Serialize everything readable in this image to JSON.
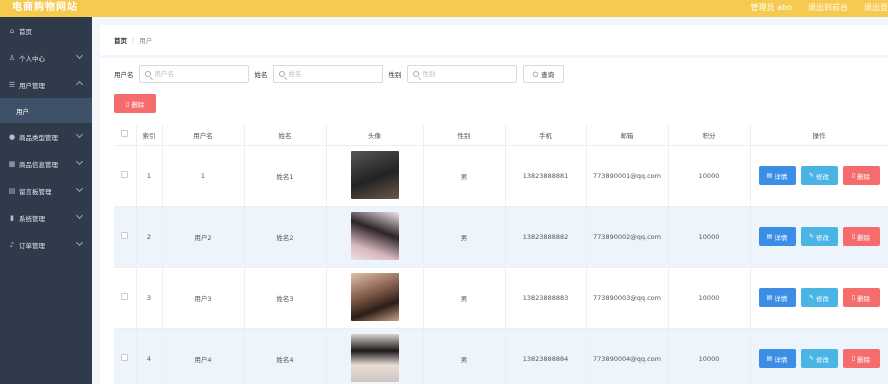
{
  "header": {
    "brand": "电商购物网站",
    "links": [
      "管理员 abo",
      "退出到前台",
      "退出登"
    ]
  },
  "sidebar": {
    "items": [
      {
        "label": "首页",
        "icon": "home-icon",
        "glyph": "⌂",
        "chevron": false
      },
      {
        "label": "个人中心",
        "icon": "user-icon",
        "glyph": "♙",
        "chevron": true
      },
      {
        "label": "用户管理",
        "icon": "menu-icon",
        "glyph": "☰",
        "chevron": true
      },
      {
        "label": "商品类型管理",
        "icon": "location-icon",
        "glyph": "●",
        "chevron": true
      },
      {
        "label": "商品信息管理",
        "icon": "grid-icon",
        "glyph": "▦",
        "chevron": true
      },
      {
        "label": "留言板管理",
        "icon": "calendar-icon",
        "glyph": "▤",
        "chevron": true
      },
      {
        "label": "系统管理",
        "icon": "chart-icon",
        "glyph": "▮",
        "chevron": true
      },
      {
        "label": "订单管理",
        "icon": "mic-icon",
        "glyph": "♪",
        "chevron": true
      }
    ],
    "sub_active": "用户"
  },
  "breadcrumb": {
    "home": "首页",
    "sep": "/",
    "current": "用户"
  },
  "search": {
    "username_label": "用户名",
    "username_placeholder": "用户名",
    "name_label": "姓名",
    "name_placeholder": "姓名",
    "gender_label": "性别",
    "gender_placeholder": "性别",
    "query_label": "查询"
  },
  "toolbar": {
    "delete_label": "删除"
  },
  "table": {
    "headers": [
      "索引",
      "用户名",
      "姓名",
      "头像",
      "性别",
      "手机",
      "邮箱",
      "积分",
      "操作"
    ],
    "rows": [
      {
        "index": "1",
        "username": "1",
        "name": "姓名1",
        "gender": "男",
        "phone": "13823888881",
        "email": "773890001@qq.com",
        "points": "10000",
        "avatar_color": "#3a3a3a"
      },
      {
        "index": "2",
        "username": "用户2",
        "name": "姓名2",
        "gender": "男",
        "phone": "13823888882",
        "email": "773890002@qq.com",
        "points": "10000",
        "avatar_color": "#d9c6cf"
      },
      {
        "index": "3",
        "username": "用户3",
        "name": "姓名3",
        "gender": "男",
        "phone": "13823888883",
        "email": "773890003@qq.com",
        "points": "10000",
        "avatar_color": "#c7a088"
      },
      {
        "index": "4",
        "username": "用户4",
        "name": "姓名4",
        "gender": "男",
        "phone": "13823888884",
        "email": "773890004@qq.com",
        "points": "10000",
        "avatar_color": "#d8d0cc"
      }
    ],
    "actions": {
      "detail": "详情",
      "edit": "修改",
      "delete": "删除"
    }
  }
}
